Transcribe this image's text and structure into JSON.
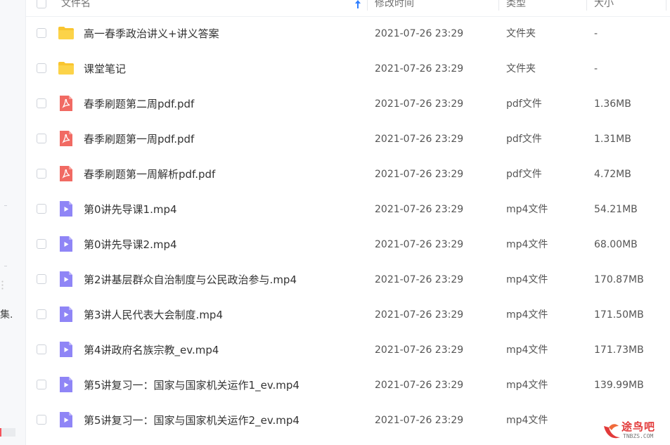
{
  "header": {
    "name_label": "文件名",
    "time_label": "修改时间",
    "type_label": "类型",
    "size_label": "大小"
  },
  "colors": {
    "folder": "#f9c530",
    "pdf": "#f16a63",
    "video": "#8f85f6",
    "sort_arrow": "#2f7fff"
  },
  "files": [
    {
      "name": "高一春季政治讲义+讲义答案",
      "time": "2021-07-26 23:29",
      "type": "文件夹",
      "size": "-",
      "icon": "folder-icon"
    },
    {
      "name": "课堂笔记",
      "time": "2021-07-26 23:29",
      "type": "文件夹",
      "size": "-",
      "icon": "folder-icon"
    },
    {
      "name": "春季刷题第二周pdf.pdf",
      "time": "2021-07-26 23:29",
      "type": "pdf文件",
      "size": "1.36MB",
      "icon": "pdf-icon"
    },
    {
      "name": "春季刷题第一周pdf.pdf",
      "time": "2021-07-26 23:29",
      "type": "pdf文件",
      "size": "1.31MB",
      "icon": "pdf-icon"
    },
    {
      "name": "春季刷题第一周解析pdf.pdf",
      "time": "2021-07-26 23:29",
      "type": "pdf文件",
      "size": "4.72MB",
      "icon": "pdf-icon"
    },
    {
      "name": "第0讲先导课1.mp4",
      "time": "2021-07-26 23:29",
      "type": "mp4文件",
      "size": "54.21MB",
      "icon": "video-icon"
    },
    {
      "name": "第0讲先导课2.mp4",
      "time": "2021-07-26 23:29",
      "type": "mp4文件",
      "size": "68.00MB",
      "icon": "video-icon"
    },
    {
      "name": "第2讲基层群众自治制度与公民政治参与.mp4",
      "time": "2021-07-26 23:29",
      "type": "mp4文件",
      "size": "170.87MB",
      "icon": "video-icon"
    },
    {
      "name": "第3讲人民代表大会制度.mp4",
      "time": "2021-07-26 23:29",
      "type": "mp4文件",
      "size": "171.50MB",
      "icon": "video-icon"
    },
    {
      "name": "第4讲政府名族宗教_ev.mp4",
      "time": "2021-07-26 23:29",
      "type": "mp4文件",
      "size": "171.73MB",
      "icon": "video-icon"
    },
    {
      "name": "第5讲复习一：国家与国家机关运作1_ev.mp4",
      "time": "2021-07-26 23:29",
      "type": "mp4文件",
      "size": "139.99MB",
      "icon": "video-icon"
    },
    {
      "name": "第5讲复习一：国家与国家机关运作2_ev.mp4",
      "time": "2021-07-26 23:29",
      "type": "mp4文件",
      "size": "",
      "icon": "video-icon"
    }
  ],
  "sidebar": {
    "fragment_text": "集..."
  },
  "watermark": {
    "text": "途鸟吧",
    "sub": "TNBZS.COM"
  }
}
